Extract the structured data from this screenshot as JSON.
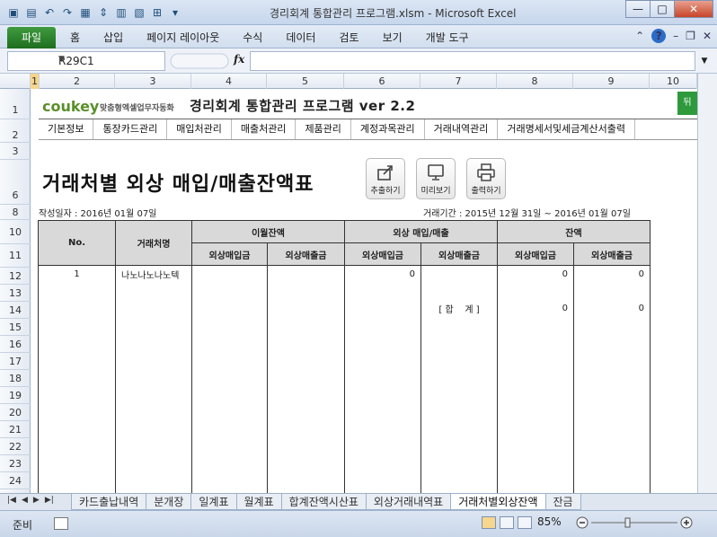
{
  "window": {
    "title": "경리회계 통합관리 프로그램.xlsm - Microsoft Excel",
    "min": "—",
    "max": "□",
    "close": "✕"
  },
  "ribbon": {
    "file_tab": "파일",
    "tabs": [
      "홈",
      "삽입",
      "페이지 레이아웃",
      "수식",
      "데이터",
      "검토",
      "보기",
      "개발 도구"
    ]
  },
  "formula_bar": {
    "name_box": "R29C1",
    "fx": "fx",
    "value": ""
  },
  "columns": [
    "1",
    "2",
    "3",
    "4",
    "5",
    "6",
    "7",
    "8",
    "9",
    "10"
  ],
  "rows": [
    "1",
    "2",
    "3",
    "6",
    "8",
    "10",
    "11",
    "12",
    "13",
    "14",
    "15",
    "16",
    "17",
    "18",
    "19",
    "20",
    "21",
    "22",
    "23",
    "24"
  ],
  "header": {
    "logo": "coukey",
    "logo_sub": "맞춤형엑셀업무자동화",
    "app_title": "경리회계 통합관리 프로그램 ver 2.2",
    "green_button": "뒤"
  },
  "menu": [
    "기본정보",
    "통장카드관리",
    "매입처관리",
    "매출처관리",
    "제품관리",
    "계정과목관리",
    "거래내역관리",
    "거래명세서및세금계산서출력"
  ],
  "report": {
    "title": "거래처별 외상 매입/매출잔액표",
    "buttons": {
      "export": "추출하기",
      "preview": "미리보기",
      "print": "출력하기"
    },
    "created": "작성일자 : 2016년 01월 07일",
    "period": "거래기간 : 2015년 12월 31일 ~ 2016년 01월 07일"
  },
  "table": {
    "h_no": "No.",
    "h_vendor": "거래처명",
    "h_prev": "이월잔액",
    "h_trade": "외상 매입/매출",
    "h_balance": "잔액",
    "sub_purchase": "외상매입금",
    "sub_sales": "외상매출금",
    "row1": {
      "no": "1",
      "vendor": "나노나노나노텍",
      "trade_purchase": "0",
      "bal_purchase": "0",
      "bal_sales": "0"
    },
    "total": {
      "label": "[ 합    계 ]",
      "bal_purchase": "0",
      "bal_sales": "0"
    }
  },
  "sheet_tabs": [
    "카드출납내역",
    "분개장",
    "일계표",
    "월계표",
    "합계잔액시산표",
    "외상거래내역표",
    "거래처별외상잔액",
    "잔금"
  ],
  "status": {
    "ready": "준비",
    "zoom": "85%"
  }
}
